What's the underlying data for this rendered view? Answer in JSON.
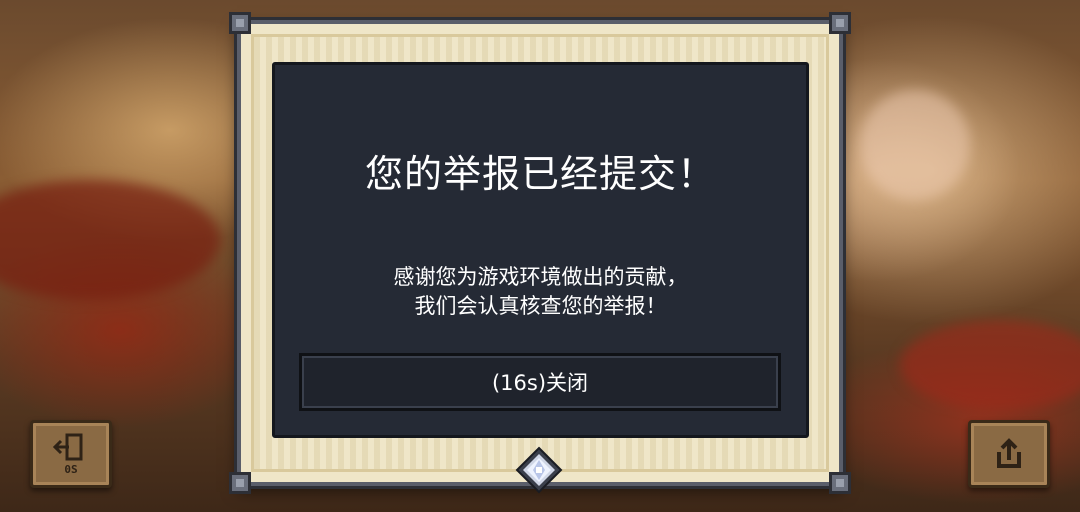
{
  "dialog": {
    "title": "您的举报已经提交！",
    "message_lines": [
      "感谢您为游戏环境做出的贡献，",
      "我们会认真核查您的举报！"
    ],
    "close_button_label": "(16s)关闭"
  },
  "exit_button": {
    "icon": "exit-door-icon",
    "label": "0S"
  },
  "share_button": {
    "icon": "share-upload-icon"
  },
  "decoration": {
    "gem_icon": "diamond-gem-icon"
  },
  "colors": {
    "panel": "#252a35",
    "frame": "#efe6c8",
    "button": "#1f232c",
    "side_button": "#8a6a44"
  }
}
